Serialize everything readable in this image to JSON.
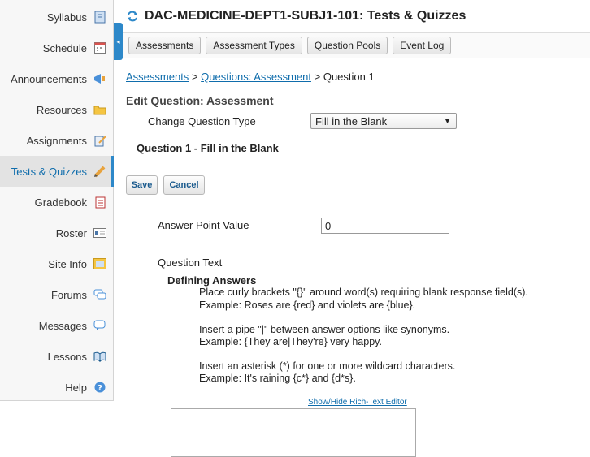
{
  "sidebar": {
    "items": [
      {
        "label": "Syllabus",
        "icon": "syllabus-icon"
      },
      {
        "label": "Schedule",
        "icon": "calendar-icon"
      },
      {
        "label": "Announcements",
        "icon": "megaphone-icon"
      },
      {
        "label": "Resources",
        "icon": "folder-icon"
      },
      {
        "label": "Assignments",
        "icon": "edit-document-icon"
      },
      {
        "label": "Tests & Quizzes",
        "icon": "pencil-icon",
        "active": true
      },
      {
        "label": "Gradebook",
        "icon": "gradebook-icon"
      },
      {
        "label": "Roster",
        "icon": "id-card-icon"
      },
      {
        "label": "Site Info",
        "icon": "site-info-icon"
      },
      {
        "label": "Forums",
        "icon": "speech-bubbles-icon"
      },
      {
        "label": "Messages",
        "icon": "message-bubble-icon"
      },
      {
        "label": "Lessons",
        "icon": "book-icon"
      },
      {
        "label": "Help",
        "icon": "help-icon"
      }
    ]
  },
  "collapse": {
    "glyph": "◂"
  },
  "header": {
    "title": "DAC-MEDICINE-DEPT1-SUBJ1-101: Tests & Quizzes"
  },
  "toolbar": {
    "buttons": [
      "Assessments",
      "Assessment Types",
      "Question Pools",
      "Event Log"
    ]
  },
  "breadcrumb": {
    "link1": "Assessments",
    "sep": ">",
    "link2": "Questions: Assessment",
    "current": "Question 1"
  },
  "form": {
    "section_title": "Edit Question: Assessment",
    "change_type_label": "Change Question Type",
    "change_type_value": "Fill in the Blank",
    "question_heading": "Question 1 - Fill in the Blank",
    "save_label": "Save",
    "cancel_label": "Cancel",
    "points_label": "Answer Point Value",
    "points_value": "0",
    "question_text_label": "Question Text",
    "defining_title": "Defining Answers",
    "instructions": [
      "Place curly brackets \"{}\" around word(s) requiring blank response field(s).",
      "Example: Roses are {red} and violets are {blue}.",
      "Insert a pipe \"|\" between answer options like synonyms.",
      "Example: {They are|They're} very happy.",
      "Insert an asterisk (*) for one or more wildcard characters.",
      "Example: It's raining {c*} and {d*s}."
    ],
    "rte_toggle": "Show/Hide Rich-Text Editor"
  },
  "colors": {
    "accent": "#2d88c9",
    "link": "#0f6dac"
  }
}
